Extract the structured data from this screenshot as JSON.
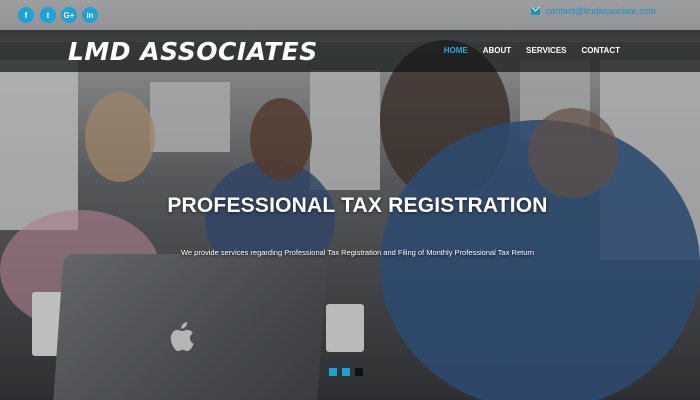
{
  "topbar": {
    "social": [
      {
        "icon": "facebook-icon",
        "glyph": "f"
      },
      {
        "icon": "twitter-icon",
        "glyph": "t"
      },
      {
        "icon": "google-plus-icon",
        "glyph": "G+"
      },
      {
        "icon": "linkedin-icon",
        "glyph": "in"
      }
    ],
    "email": "contact@lmdassociate.com",
    "accent": "#1aa3d8"
  },
  "navbar": {
    "logo": "LMD ASSOCIATES",
    "items": [
      "HOME",
      "ABOUT",
      "SERVICES",
      "CONTACT"
    ],
    "active": "HOME"
  },
  "hero": {
    "headline": "PROFESSIONAL TAX REGISTRATION",
    "subline": "We provide services regarding Professional Tax Registration and Filing of Monthly Professional Tax Return"
  },
  "slider": {
    "dots": 3,
    "active_index": 0
  }
}
